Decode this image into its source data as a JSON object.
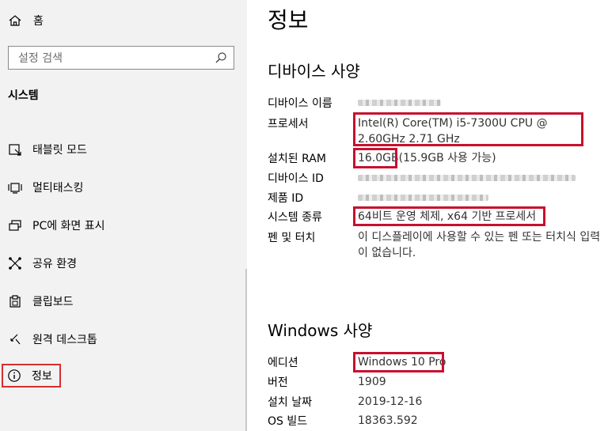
{
  "sidebar": {
    "home_label": "홈",
    "search_placeholder": "설정 검색",
    "section_title": "시스템",
    "items": [
      {
        "label": "태블릿 모드",
        "icon": "tablet-mode-icon"
      },
      {
        "label": "멀티태스킹",
        "icon": "multitasking-icon"
      },
      {
        "label": "PC에 화면 표시",
        "icon": "project-icon"
      },
      {
        "label": "공유 환경",
        "icon": "shared-experiences-icon"
      },
      {
        "label": "클립보드",
        "icon": "clipboard-icon"
      },
      {
        "label": "원격 데스크톱",
        "icon": "remote-desktop-icon"
      },
      {
        "label": "정보",
        "icon": "info-icon",
        "selected": true
      }
    ]
  },
  "main": {
    "title": "정보",
    "device_specs_title": "디바이스 사양",
    "device_specs": [
      {
        "label": "디바이스 이름",
        "value": ""
      },
      {
        "label": "프로세서",
        "value": "Intel(R) Core(TM) i5-7300U CPU @ 2.60GHz 2.71 GHz"
      },
      {
        "label": "설치된 RAM",
        "value": "16.0GB(15.9GB 사용 가능)"
      },
      {
        "label": "디바이스 ID",
        "value": ""
      },
      {
        "label": "제품 ID",
        "value": ""
      },
      {
        "label": "시스템 종류",
        "value": "64비트 운영 체제, x64 기반 프로세서"
      },
      {
        "label": "펜 및 터치",
        "value": "이 디스플레이에 사용할 수 있는 펜 또는 터치식 입력이 없습니다."
      }
    ],
    "windows_specs_title": "Windows 사양",
    "windows_specs": [
      {
        "label": "에디션",
        "value": "Windows 10 Pro"
      },
      {
        "label": "버전",
        "value": "1909"
      },
      {
        "label": "설치 날짜",
        "value": "2019-12-16"
      },
      {
        "label": "OS 빌드",
        "value": "18363.592"
      }
    ]
  },
  "colors": {
    "highlight": "#c8102e",
    "sidebar_bg": "#f2f2f2"
  }
}
